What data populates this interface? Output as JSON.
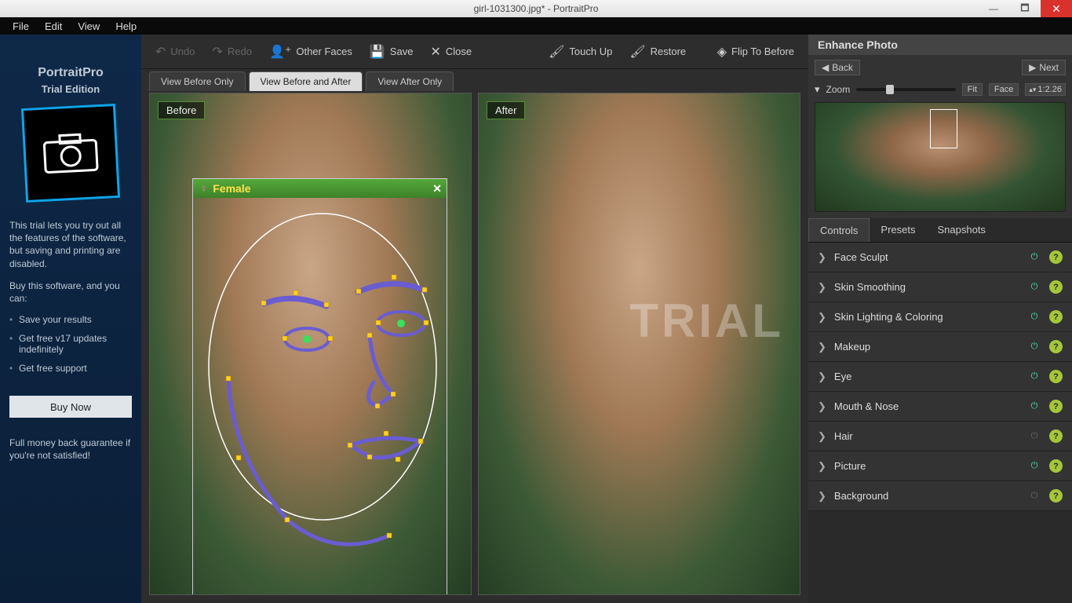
{
  "window": {
    "title": "girl-1031300.jpg* - PortraitPro"
  },
  "menubar": [
    "File",
    "Edit",
    "View",
    "Help"
  ],
  "left": {
    "title": "PortraitPro",
    "subtitle": "Trial Edition",
    "intro": "This trial lets you try out all the features of the software, but saving and printing are disabled.",
    "buy_prompt": "Buy this software, and you can:",
    "bullets": [
      "Save your results",
      "Get free v17 updates indefinitely",
      "Get free support"
    ],
    "buy_btn": "Buy Now",
    "guarantee": "Full money back guarantee if you're not satisfied!"
  },
  "toolbar": {
    "undo": "Undo",
    "redo": "Redo",
    "other_faces": "Other Faces",
    "save": "Save",
    "close": "Close",
    "touch_up": "Touch Up",
    "restore": "Restore",
    "flip": "Flip To Before"
  },
  "view_tabs": {
    "before_only": "View Before Only",
    "before_after": "View Before and After",
    "after_only": "View After Only"
  },
  "viewport": {
    "before_label": "Before",
    "after_label": "After",
    "gender_label": "Female",
    "watermark": "TRIAL"
  },
  "right": {
    "title": "Enhance Photo",
    "back": "Back",
    "next": "Next",
    "zoom_label": "Zoom",
    "fit": "Fit",
    "face": "Face",
    "zoom_value": "1:2.26",
    "tabs": {
      "controls": "Controls",
      "presets": "Presets",
      "snapshots": "Snapshots"
    },
    "controls": [
      {
        "label": "Face Sculpt",
        "on": true
      },
      {
        "label": "Skin Smoothing",
        "on": true
      },
      {
        "label": "Skin Lighting & Coloring",
        "on": true
      },
      {
        "label": "Makeup",
        "on": true
      },
      {
        "label": "Eye",
        "on": true
      },
      {
        "label": "Mouth & Nose",
        "on": true
      },
      {
        "label": "Hair",
        "on": false
      },
      {
        "label": "Picture",
        "on": true
      },
      {
        "label": "Background",
        "on": false
      }
    ]
  }
}
